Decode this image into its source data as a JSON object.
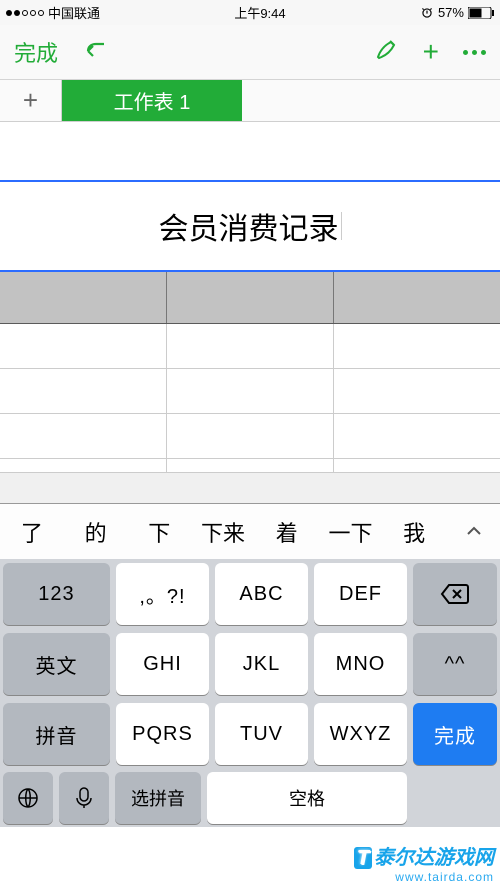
{
  "status": {
    "carrier": "中国联通",
    "time": "上午9:44",
    "battery_pct": "57%"
  },
  "toolbar": {
    "done": "完成"
  },
  "sheet": {
    "tab1": "工作表 1",
    "title_cell": "会员消费记录"
  },
  "candidates": {
    "c0": "了",
    "c1": "的",
    "c2": "下",
    "c3": "下来",
    "c4": "着",
    "c5": "一下",
    "c6": "我"
  },
  "keyboard": {
    "r0k0": "123",
    "r0k1": ",。?!",
    "r0k2": "ABC",
    "r0k3": "DEF",
    "r1k0": "英文",
    "r1k1": "GHI",
    "r1k2": "JKL",
    "r1k3": "MNO",
    "r1k4": "^^",
    "r2k0": "拼音",
    "r2k1": "PQRS",
    "r2k2": "TUV",
    "r2k3": "WXYZ",
    "done": "完成",
    "choose": "选拼音",
    "space": "空格"
  },
  "watermark": {
    "line1": "泰尔达游戏网",
    "line2": "www.tairda.com"
  }
}
